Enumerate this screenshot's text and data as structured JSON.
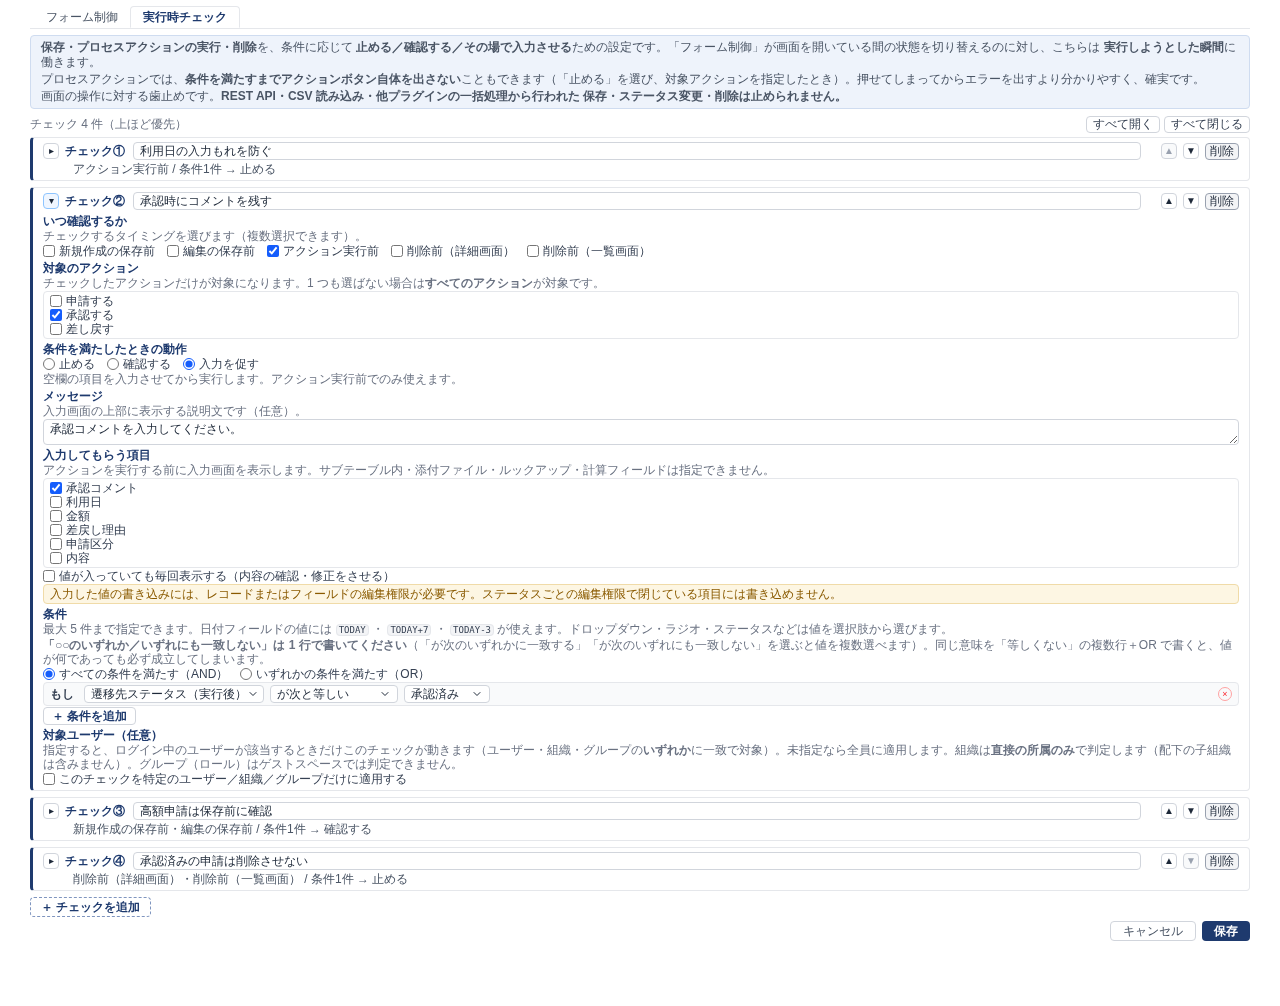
{
  "tabs": [
    {
      "label": "フォーム制御",
      "selected": false
    },
    {
      "label": "実行時チェック",
      "selected": true
    }
  ],
  "info": [
    "**保存・プロセスアクションの実行・削除**を、条件に応じて **止める／確認する／その場で入力させる**ための設定です。「フォーム制御」が画面を開いている間の状態を切り替えるのに対し、こちらは **実行しようとした瞬間**に働きます。",
    "プロセスアクションでは、**条件を満たすまでアクションボタン自体を出さない**こともできます（「止める」を選び、対象アクションを指定したとき）。押せてしまってからエラーを出すより分かりやすく、確実です。",
    "画面の操作に対する歯止めです。**REST API・CSV 読み込み・他プラグインの一括処理から行われた 保存・ステータス変更・削除は止められません。**"
  ],
  "list_header": {
    "count": "チェック 4 件（上ほど優先）",
    "buttons": [
      "すべて開く",
      "すべて閉じる"
    ]
  },
  "checks": [
    {
      "toggle": "▸",
      "expanded": false,
      "label": "チェック①",
      "name": "利用日の入力もれを防ぐ",
      "up": {
        "symbol": "▲",
        "disabled": true
      },
      "down": {
        "symbol": "▼",
        "disabled": false
      },
      "delete": "削除",
      "summary": "アクション実行前 / 条件1件 → 止める"
    },
    {
      "toggle": "▾",
      "expanded": true,
      "label": "チェック②",
      "name": "承認時にコメントを残す",
      "up": {
        "symbol": "▲",
        "disabled": false
      },
      "down": {
        "symbol": "▼",
        "disabled": false
      },
      "delete": "削除",
      "details": {
        "timing": {
          "title": "いつ確認するか",
          "hint": "チェックするタイミングを選びます（複数選択できます）。",
          "options": [
            {
              "label": "新規作成の保存前",
              "checked": false
            },
            {
              "label": "編集の保存前",
              "checked": false
            },
            {
              "label": "アクション実行前",
              "checked": true
            },
            {
              "label": "削除前（詳細画面）",
              "checked": false
            },
            {
              "label": "削除前（一覧画面）",
              "checked": false
            }
          ]
        },
        "actions": {
          "title": "対象のアクション",
          "hint": "チェックしたアクションだけが対象になります。1 つも選ばない場合は**すべてのアクション**が対象です。",
          "options": [
            {
              "label": "申請する",
              "checked": false
            },
            {
              "label": "承認する",
              "checked": true
            },
            {
              "label": "差し戻す",
              "checked": false
            }
          ]
        },
        "behavior": {
          "title": "条件を満たしたときの動作",
          "options": [
            {
              "label": "止める",
              "selected": false
            },
            {
              "label": "確認する",
              "selected": false
            },
            {
              "label": "入力を促す",
              "selected": true
            }
          ],
          "hint": "空欄の項目を入力させてから実行します。アクション実行前でのみ使えます。"
        },
        "message": {
          "title": "メッセージ",
          "hint": "入力画面の上部に表示する説明文です（任意）。",
          "value": "承認コメントを入力してください。"
        },
        "inputs": {
          "title": "入力してもらう項目",
          "hint": "アクションを実行する前に入力画面を表示します。サブテーブル内・添付ファイル・ルックアップ・計算フィールドは指定できません。",
          "options": [
            {
              "label": "承認コメント",
              "checked": true
            },
            {
              "label": "利用日",
              "checked": false
            },
            {
              "label": "金額",
              "checked": false
            },
            {
              "label": "差戻し理由",
              "checked": false
            },
            {
              "label": "申請区分",
              "checked": false
            },
            {
              "label": "内容",
              "checked": false
            }
          ],
          "always": {
            "label": "値が入っていても毎回表示する（内容の確認・修正をさせる）",
            "checked": false
          },
          "warning": "入力した値の書き込みには、レコードまたはフィールドの編集権限が必要です。ステータスごとの編集権限で閉じている項目には書き込めません。"
        },
        "conditions": {
          "title": "条件",
          "hint_parts": [
            {
              "kind": "text",
              "text": "最大 5 件まで指定できます。日付フィールドの値には "
            },
            {
              "kind": "code",
              "text": "TODAY"
            },
            {
              "kind": "text",
              "text": " ・ "
            },
            {
              "kind": "code",
              "text": "TODAY+7"
            },
            {
              "kind": "text",
              "text": " ・ "
            },
            {
              "kind": "code",
              "text": "TODAY-3"
            },
            {
              "kind": "text",
              "text": " が使えます。ドロップダウン・ラジオ・ステータスなどは値を選択肢から選びます。"
            }
          ],
          "hint2": "**「○○のいずれか／いずれにも一致しない」は 1 行で書いてください**（「が次のいずれかに一致する」「が次のいずれにも一致しない」を選ぶと値を複数選べます）。同じ意味を「等しくない」の複数行＋OR で書くと、値が何であっても必ず成立してしまいます。",
          "match": [
            {
              "label": "すべての条件を満たす（AND）",
              "selected": true
            },
            {
              "label": "いずれかの条件を満たす（OR）",
              "selected": false
            }
          ],
          "rows": [
            {
              "prefix": "もし",
              "field": "遷移先ステータス（実行後）",
              "operator": "が次と等しい",
              "value": "承認済み",
              "remove": "×"
            }
          ],
          "add": "＋ 条件を追加"
        },
        "users": {
          "title": "対象ユーザー（任意）",
          "hint": "指定すると、ログイン中のユーザーが該当するときだけこのチェックが動きます（ユーザー・組織・グループの**いずれか**に一致で対象）。未指定なら全員に適用します。組織は**直接の所属のみ**で判定します（配下の子組織は含みません）。グループ（ロール）はゲストスペースでは判定できません。",
          "option": {
            "label": "このチェックを特定のユーザー／組織／グループだけに適用する",
            "checked": false
          }
        }
      }
    },
    {
      "toggle": "▸",
      "expanded": false,
      "label": "チェック③",
      "name": "高額申請は保存前に確認",
      "up": {
        "symbol": "▲",
        "disabled": false
      },
      "down": {
        "symbol": "▼",
        "disabled": false
      },
      "delete": "削除",
      "summary": "新規作成の保存前・編集の保存前 / 条件1件 → 確認する"
    },
    {
      "toggle": "▸",
      "expanded": false,
      "label": "チェック④",
      "name": "承認済みの申請は削除させない",
      "up": {
        "symbol": "▲",
        "disabled": false
      },
      "down": {
        "symbol": "▼",
        "disabled": true
      },
      "delete": "削除",
      "summary": "削除前（詳細画面）・削除前（一覧画面） / 条件1件 → 止める"
    }
  ],
  "footer": {
    "add_check": "＋ チェックを追加",
    "cancel": "キャンセル",
    "save": "保存"
  }
}
